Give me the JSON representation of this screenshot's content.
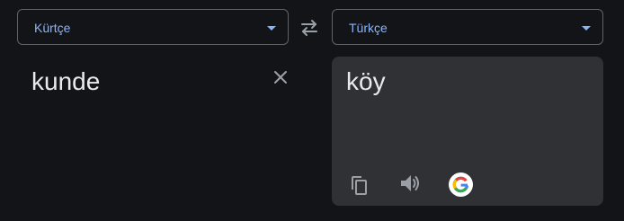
{
  "source_language": {
    "label": "Kürtçe"
  },
  "target_language": {
    "label": "Türkçe"
  },
  "source": {
    "text": "kunde"
  },
  "target": {
    "text": "köy"
  },
  "icons": {
    "dropdown": "chevron-down-icon",
    "swap": "swap-languages-icon",
    "clear": "close-icon",
    "copy": "copy-icon",
    "speak": "speaker-icon",
    "google": "google-logo-icon"
  },
  "colors": {
    "background": "#131418",
    "accent": "#8ab4f8",
    "text": "#e8eaed",
    "icon": "#9aa0a6",
    "output_panel": "#303134",
    "border": "#5f6368"
  }
}
